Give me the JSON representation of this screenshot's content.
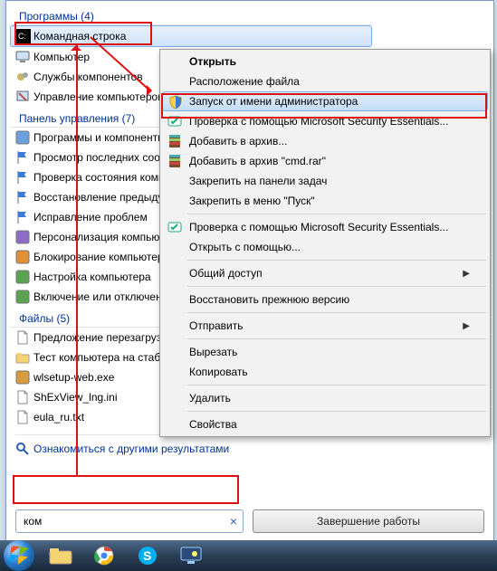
{
  "groups": {
    "programs": {
      "header": "Программы (4)"
    },
    "cpanel": {
      "header": "Панель управления (7)"
    },
    "files": {
      "header": "Файлы (5)"
    }
  },
  "programs_items": [
    {
      "label": "Командная строка"
    },
    {
      "label": "Компьютер"
    },
    {
      "label": "Службы компонентов"
    },
    {
      "label": "Управление компьютером"
    }
  ],
  "cpanel_items": [
    {
      "label": "Программы и компоненты"
    },
    {
      "label": "Просмотр последних сообщений"
    },
    {
      "label": "Проверка состояния компьютера"
    },
    {
      "label": "Восстановление предыдущего состояния"
    },
    {
      "label": "Исправление проблем"
    },
    {
      "label": "Персонализация компьютера"
    },
    {
      "label": "Блокирование компьютера"
    },
    {
      "label": "Настройка компьютера"
    },
    {
      "label": "Включение или отключение"
    }
  ],
  "files_items": [
    {
      "label": "Предложение перезагрузки"
    },
    {
      "label": "Тест компьютера на стабильность"
    },
    {
      "label": "wlsetup-web.exe"
    },
    {
      "label": "ShExView_lng.ini"
    },
    {
      "label": "eula_ru.txt"
    }
  ],
  "more_results": "Ознакомиться с другими результатами",
  "search": {
    "value": "ком"
  },
  "shutdown_label": "Завершение работы",
  "ctx": [
    {
      "type": "item",
      "label": "Открыть",
      "bold": true
    },
    {
      "type": "item",
      "label": "Расположение файла"
    },
    {
      "type": "item",
      "label": "Запуск от имени администратора",
      "icon": "shield",
      "hl": true
    },
    {
      "type": "item",
      "label": "Проверка с помощью Microsoft Security Essentials...",
      "icon": "mse"
    },
    {
      "type": "item",
      "label": "Добавить в архив...",
      "icon": "rar"
    },
    {
      "type": "item",
      "label": "Добавить в архив \"cmd.rar\"",
      "icon": "rar"
    },
    {
      "type": "item",
      "label": "Закрепить на панели задач"
    },
    {
      "type": "item",
      "label": "Закрепить в меню \"Пуск\""
    },
    {
      "type": "sep"
    },
    {
      "type": "item",
      "label": "Проверка с помощью Microsoft Security Essentials...",
      "icon": "mse"
    },
    {
      "type": "item",
      "label": "Открыть с помощью..."
    },
    {
      "type": "sep"
    },
    {
      "type": "item",
      "label": "Общий доступ",
      "sub": true
    },
    {
      "type": "sep"
    },
    {
      "type": "item",
      "label": "Восстановить прежнюю версию"
    },
    {
      "type": "sep"
    },
    {
      "type": "item",
      "label": "Отправить",
      "sub": true
    },
    {
      "type": "sep"
    },
    {
      "type": "item",
      "label": "Вырезать"
    },
    {
      "type": "item",
      "label": "Копировать"
    },
    {
      "type": "sep"
    },
    {
      "type": "item",
      "label": "Удалить"
    },
    {
      "type": "sep"
    },
    {
      "type": "item",
      "label": "Свойства"
    }
  ],
  "annotations": {
    "highlight_item": "Командная строка",
    "highlight_menu_item": "Запуск от имени администратора",
    "highlight_search": true
  }
}
